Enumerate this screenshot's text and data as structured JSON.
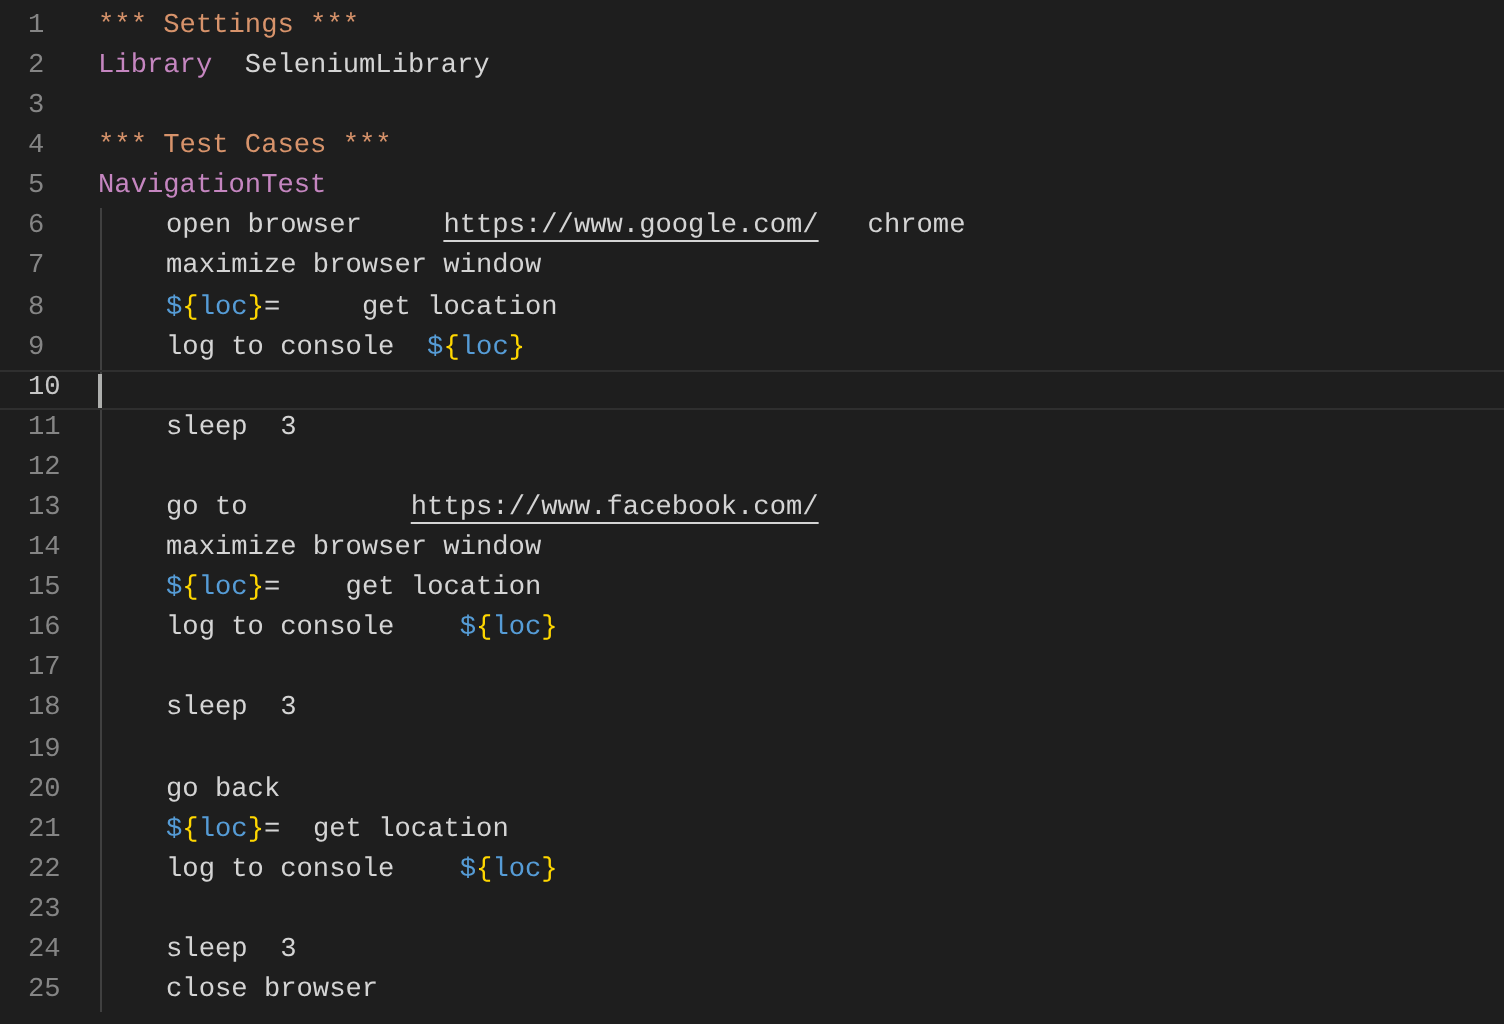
{
  "editor": {
    "lines": [
      {
        "number": "1",
        "current": false,
        "indented": false,
        "tokens": [
          {
            "kind": "header",
            "text": "*** Settings ***"
          }
        ]
      },
      {
        "number": "2",
        "current": false,
        "indented": false,
        "tokens": [
          {
            "kind": "keyword",
            "text": "Library"
          },
          {
            "kind": "plain",
            "text": "  SeleniumLibrary"
          }
        ]
      },
      {
        "number": "3",
        "current": false,
        "indented": false
      },
      {
        "number": "4",
        "current": false,
        "indented": false,
        "tokens": [
          {
            "kind": "header",
            "text": "*** Test Cases ***"
          }
        ]
      },
      {
        "number": "5",
        "current": false,
        "indented": false,
        "tokens": [
          {
            "kind": "keyword",
            "text": "NavigationTest"
          }
        ]
      },
      {
        "number": "6",
        "current": false,
        "indented": true,
        "tokens": [
          {
            "kind": "plain",
            "text": "open browser     "
          },
          {
            "kind": "link",
            "text": "https://www.google.com/"
          },
          {
            "kind": "plain",
            "text": "   chrome"
          }
        ]
      },
      {
        "number": "7",
        "current": false,
        "indented": true,
        "tokens": [
          {
            "kind": "plain",
            "text": "maximize browser window"
          }
        ]
      },
      {
        "number": "8",
        "current": false,
        "indented": true,
        "tokens": [
          {
            "kind": "sigil",
            "text": "$"
          },
          {
            "kind": "brace",
            "text": "{"
          },
          {
            "kind": "var",
            "text": "loc"
          },
          {
            "kind": "brace",
            "text": "}"
          },
          {
            "kind": "plain",
            "text": "=     get location"
          }
        ]
      },
      {
        "number": "9",
        "current": false,
        "indented": true,
        "tokens": [
          {
            "kind": "plain",
            "text": "log to console  "
          },
          {
            "kind": "sigil",
            "text": "$"
          },
          {
            "kind": "brace",
            "text": "{"
          },
          {
            "kind": "var",
            "text": "loc"
          },
          {
            "kind": "brace",
            "text": "}"
          }
        ]
      },
      {
        "number": "10",
        "current": true,
        "indented": true
      },
      {
        "number": "11",
        "current": false,
        "indented": true,
        "tokens": [
          {
            "kind": "plain",
            "text": "sleep  3"
          }
        ]
      },
      {
        "number": "12",
        "current": false,
        "indented": true
      },
      {
        "number": "13",
        "current": false,
        "indented": true,
        "tokens": [
          {
            "kind": "plain",
            "text": "go to          "
          },
          {
            "kind": "link",
            "text": "https://www.facebook.com/"
          }
        ]
      },
      {
        "number": "14",
        "current": false,
        "indented": true,
        "tokens": [
          {
            "kind": "plain",
            "text": "maximize browser window"
          }
        ]
      },
      {
        "number": "15",
        "current": false,
        "indented": true,
        "tokens": [
          {
            "kind": "sigil",
            "text": "$"
          },
          {
            "kind": "brace",
            "text": "{"
          },
          {
            "kind": "var",
            "text": "loc"
          },
          {
            "kind": "brace",
            "text": "}"
          },
          {
            "kind": "plain",
            "text": "=    get location"
          }
        ]
      },
      {
        "number": "16",
        "current": false,
        "indented": true,
        "tokens": [
          {
            "kind": "plain",
            "text": "log to console    "
          },
          {
            "kind": "sigil",
            "text": "$"
          },
          {
            "kind": "brace",
            "text": "{"
          },
          {
            "kind": "var",
            "text": "loc"
          },
          {
            "kind": "brace",
            "text": "}"
          }
        ]
      },
      {
        "number": "17",
        "current": false,
        "indented": true
      },
      {
        "number": "18",
        "current": false,
        "indented": true,
        "tokens": [
          {
            "kind": "plain",
            "text": "sleep  3"
          }
        ]
      },
      {
        "number": "19",
        "current": false,
        "indented": true
      },
      {
        "number": "20",
        "current": false,
        "indented": true,
        "tokens": [
          {
            "kind": "plain",
            "text": "go back"
          }
        ]
      },
      {
        "number": "21",
        "current": false,
        "indented": true,
        "tokens": [
          {
            "kind": "sigil",
            "text": "$"
          },
          {
            "kind": "brace",
            "text": "{"
          },
          {
            "kind": "var",
            "text": "loc"
          },
          {
            "kind": "brace",
            "text": "}"
          },
          {
            "kind": "plain",
            "text": "=  get location"
          }
        ]
      },
      {
        "number": "22",
        "current": false,
        "indented": true,
        "tokens": [
          {
            "kind": "plain",
            "text": "log to console    "
          },
          {
            "kind": "sigil",
            "text": "$"
          },
          {
            "kind": "brace",
            "text": "{"
          },
          {
            "kind": "var",
            "text": "loc"
          },
          {
            "kind": "brace",
            "text": "}"
          }
        ]
      },
      {
        "number": "23",
        "current": false,
        "indented": true
      },
      {
        "number": "24",
        "current": false,
        "indented": true,
        "tokens": [
          {
            "kind": "plain",
            "text": "sleep  3"
          }
        ]
      },
      {
        "number": "25",
        "current": false,
        "indented": true,
        "tokens": [
          {
            "kind": "plain",
            "text": "close browser"
          }
        ]
      }
    ]
  }
}
